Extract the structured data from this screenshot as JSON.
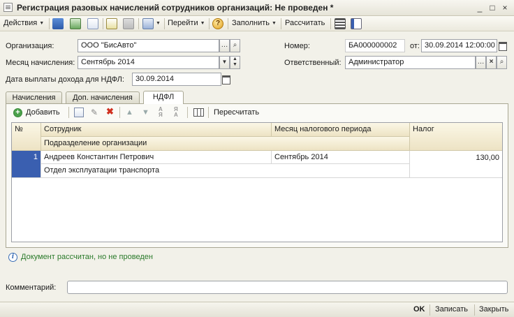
{
  "window": {
    "title": "Регистрация разовых начислений сотрудников организаций: Не проведен *",
    "controls": [
      "_",
      "□",
      "×"
    ]
  },
  "toolbar": {
    "actions": "Действия",
    "goto": "Перейти",
    "fill": "Заполнить",
    "calculate": "Рассчитать"
  },
  "form": {
    "org_label": "Организация:",
    "org_value": "ООО \"БисАвто\"",
    "month_label": "Месяц начисления:",
    "month_value": "Сентябрь 2014",
    "pay_date_label": "Дата выплаты дохода для НДФЛ:",
    "pay_date_value": "30.09.2014",
    "number_label": "Номер:",
    "number_value": "БА000000002",
    "from_label": "от:",
    "from_value": "30.09.2014 12:00:00",
    "responsible_label": "Ответственный:",
    "responsible_value": "Администратор"
  },
  "tabs": [
    {
      "label": "Начисления"
    },
    {
      "label": "Доп. начисления"
    },
    {
      "label": "НДФЛ"
    }
  ],
  "tab_toolbar": {
    "add": "Добавить",
    "recalc": "Пересчитать"
  },
  "table": {
    "headers": {
      "num": "№",
      "employee": "Сотрудник",
      "department": "Подразделение организации",
      "period": "Месяц налогового периода",
      "tax": "Налог"
    },
    "rows": [
      {
        "num": "1",
        "employee": "Андреев Константин Петрович",
        "department": "Отдел эксплуатации транспорта",
        "period": "Сентябрь 2014",
        "tax": "130,00"
      }
    ]
  },
  "status": {
    "message": "Документ рассчитан, но не проведен"
  },
  "comment": {
    "label": "Комментарий:",
    "value": ""
  },
  "footer": {
    "ok": "OK",
    "save": "Записать",
    "close": "Закрыть"
  },
  "colors": {
    "accent": "#3a5fb0",
    "status_text": "#2a7a2a"
  }
}
